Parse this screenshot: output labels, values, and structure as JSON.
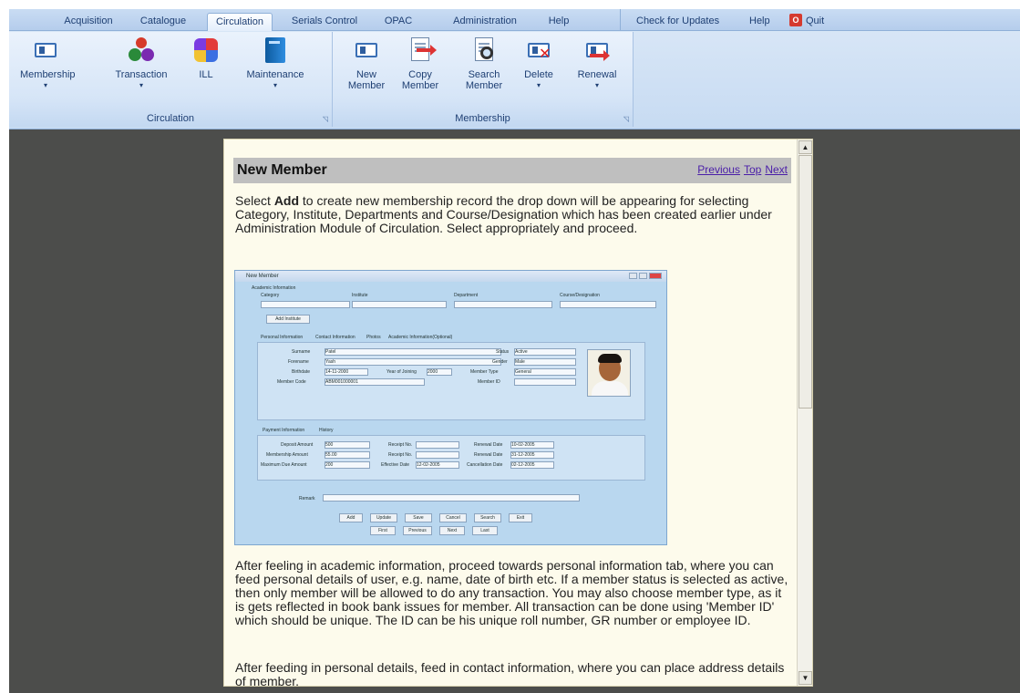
{
  "ribbon": {
    "tabs": [
      "Acquisition",
      "Catalogue",
      "Circulation",
      "Serials Control",
      "OPAC",
      "Administration",
      "Help"
    ],
    "active_tab": "Circulation",
    "tools": {
      "check_updates": "Check for Updates",
      "help": "Help",
      "quit": "Quit"
    },
    "groups": [
      {
        "label": "Circulation",
        "buttons": [
          "Membership",
          "Transaction",
          "ILL",
          "Maintenance"
        ]
      },
      {
        "label": "Membership",
        "buttons": [
          "New Member",
          "Copy Member",
          "Search Member",
          "Delete",
          "Renewal"
        ]
      }
    ],
    "new_member": [
      "New",
      "Member"
    ],
    "copy_member": [
      "Copy",
      "Member"
    ],
    "search_member": [
      "Search",
      "Member"
    ]
  },
  "help": {
    "title": "New Member",
    "nav": {
      "previous": "Previous",
      "top": "Top",
      "next": "Next"
    },
    "para1_pre": "Select ",
    "para1_bold": "Add",
    "para1_post": " to create new membership record the drop down will be appearing for selecting Category, Institute, Departments and Course/Designation which has been created earlier under Administration Module of Circulation.  Select appropriately and proceed.",
    "para2": "After feeling in academic information, proceed towards personal information tab, where you can feed personal details of user, e.g. name, date of birth etc. If a member status is selected as active, then only member will be allowed to do any transaction. You may also choose member type, as it is gets reflected in book bank issues for member. All transaction can be done using 'Member ID' which should be unique. The ID can be his unique roll number, GR number or employee ID.",
    "para3": "After feeding in personal details, feed in contact information, where you can place address details of member."
  },
  "screenshot": {
    "window_title": "New Member",
    "academic_label": "Academic Information",
    "fields": [
      "Category",
      "Institute",
      "Department",
      "Course/Designation"
    ],
    "add_institute": "Add Institute",
    "tabs": [
      "Personal Information",
      "Contact Information",
      "Photos",
      "Academic Information(Optional)"
    ],
    "personal_labels": [
      "Surname",
      "Forename",
      "Birthdate",
      "Member Code"
    ],
    "personal_values": [
      "Patel",
      "Yash",
      "14-11-2000",
      "ABM001000001"
    ],
    "year_joining": "Year of Joining",
    "year_value": "2000",
    "right_labels": [
      "Status",
      "Gender",
      "Member Type",
      "Member ID"
    ],
    "right_values": [
      "Active",
      "Male",
      "General",
      ""
    ],
    "payment_tabs": [
      "Payment Information",
      "History"
    ],
    "payment_labels": [
      "Deposit Amount",
      "Membership Amount",
      "Maximum Due Amount"
    ],
    "payment_values": [
      "500",
      "55.00",
      "200"
    ],
    "receipt_label": "Receipt No.",
    "date_labels": [
      "Renewal Date",
      "Renewal Date",
      "Cancellation Date"
    ],
    "date_values": [
      "10-02-2005",
      "31-12-2005",
      "02-12-2005"
    ],
    "effective": "Effective Date",
    "effective_value": "12-02-2005",
    "remark": "Remark",
    "buttons_row1": [
      "Add",
      "Update",
      "Save",
      "Cancel",
      "Search",
      "Exit"
    ],
    "buttons_row2": [
      "First",
      "Previous",
      "Next",
      "Last"
    ]
  }
}
